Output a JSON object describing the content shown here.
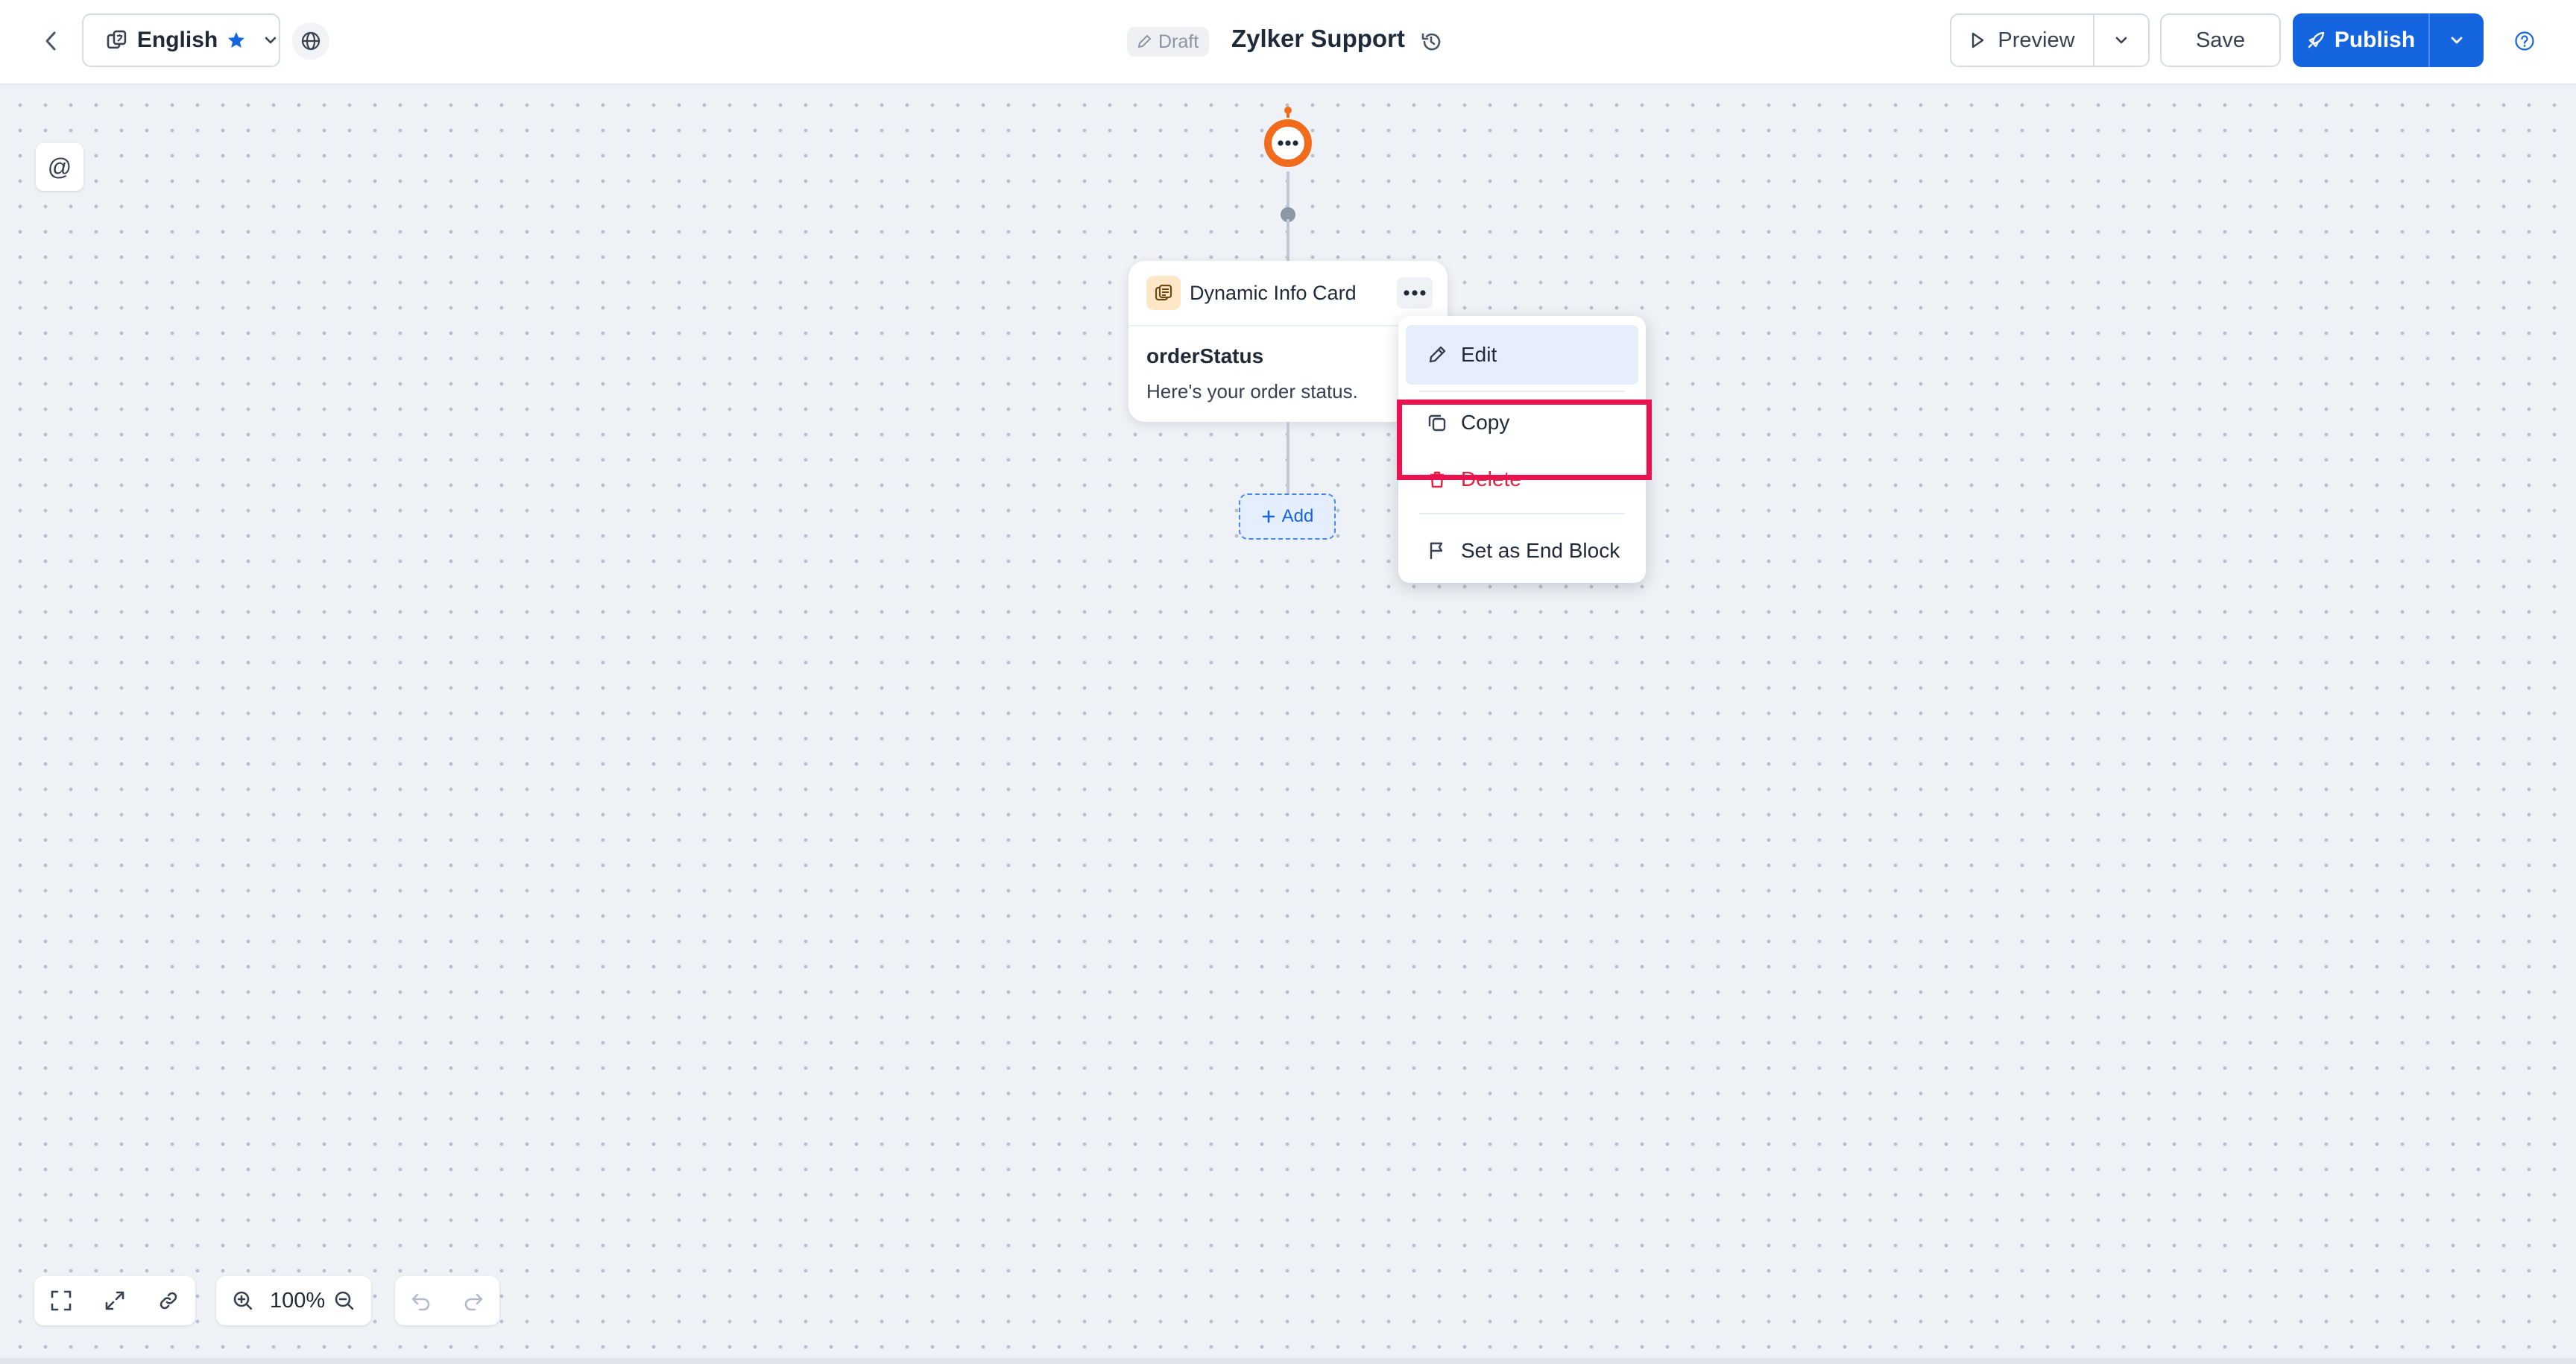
{
  "header": {
    "language": "English",
    "status_badge": "Draft",
    "title": "Zylker Support",
    "preview_label": "Preview",
    "save_label": "Save",
    "publish_label": "Publish"
  },
  "canvas": {
    "mention_symbol": "@",
    "card": {
      "type_label": "Dynamic Info Card",
      "name": "orderStatus",
      "message": "Here's your order status."
    },
    "add_label": "Add"
  },
  "menu": {
    "items": [
      {
        "label": "Edit",
        "icon": "pencil-icon"
      },
      {
        "label": "Copy",
        "icon": "copy-icon"
      },
      {
        "label": "Delete",
        "icon": "trash-icon"
      },
      {
        "label": "Set as End Block",
        "icon": "flag-icon"
      }
    ]
  },
  "toolbar": {
    "zoom": "100%"
  },
  "colors": {
    "accent": "#1565e0",
    "danger": "#e0213f",
    "highlight": "#e8134f",
    "bot_orange": "#f26b1d"
  }
}
